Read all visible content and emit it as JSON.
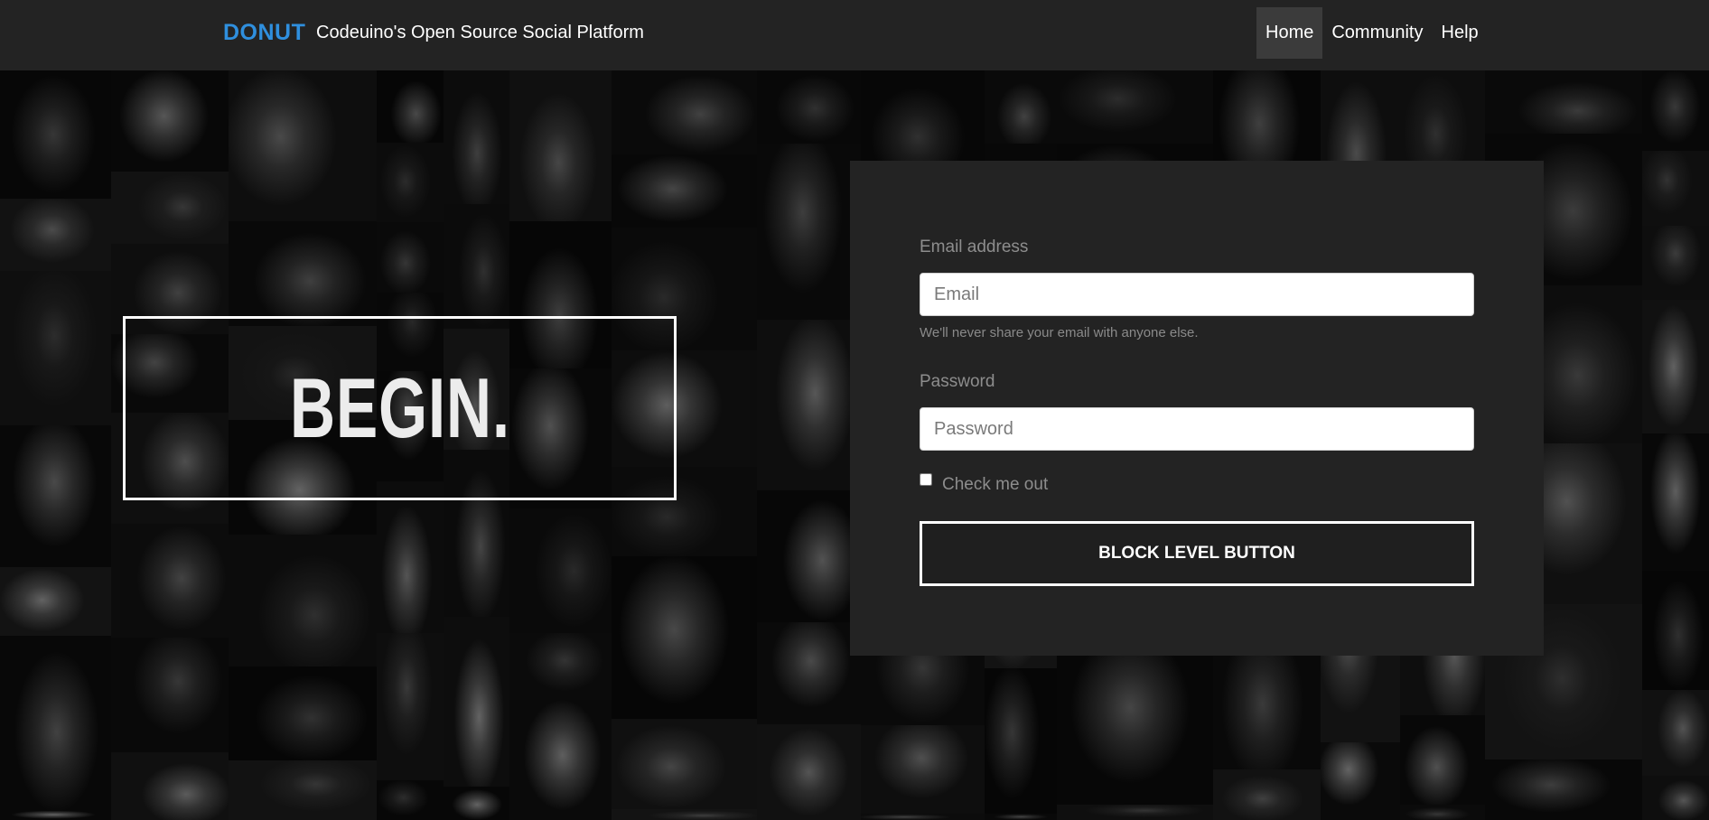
{
  "navbar": {
    "brand": "DONUT",
    "tagline": "Codeuino's Open Source Social Platform",
    "links": [
      {
        "label": "Home",
        "active": true
      },
      {
        "label": "Community",
        "active": false
      },
      {
        "label": "Help",
        "active": false
      }
    ]
  },
  "hero": {
    "title": "BEGIN."
  },
  "form": {
    "email_label": "Email address",
    "email_placeholder": "Email",
    "email_help": "We'll never share your email with anyone else.",
    "password_label": "Password",
    "password_placeholder": "Password",
    "checkbox_label": "Check me out",
    "checkbox_checked": false,
    "submit_label": "BLOCK LEVEL BUTTON"
  },
  "colors": {
    "brand": "#2f8fde",
    "navbar_bg": "#232323",
    "card_bg": "#232323",
    "text_muted": "#8d8d8d"
  }
}
